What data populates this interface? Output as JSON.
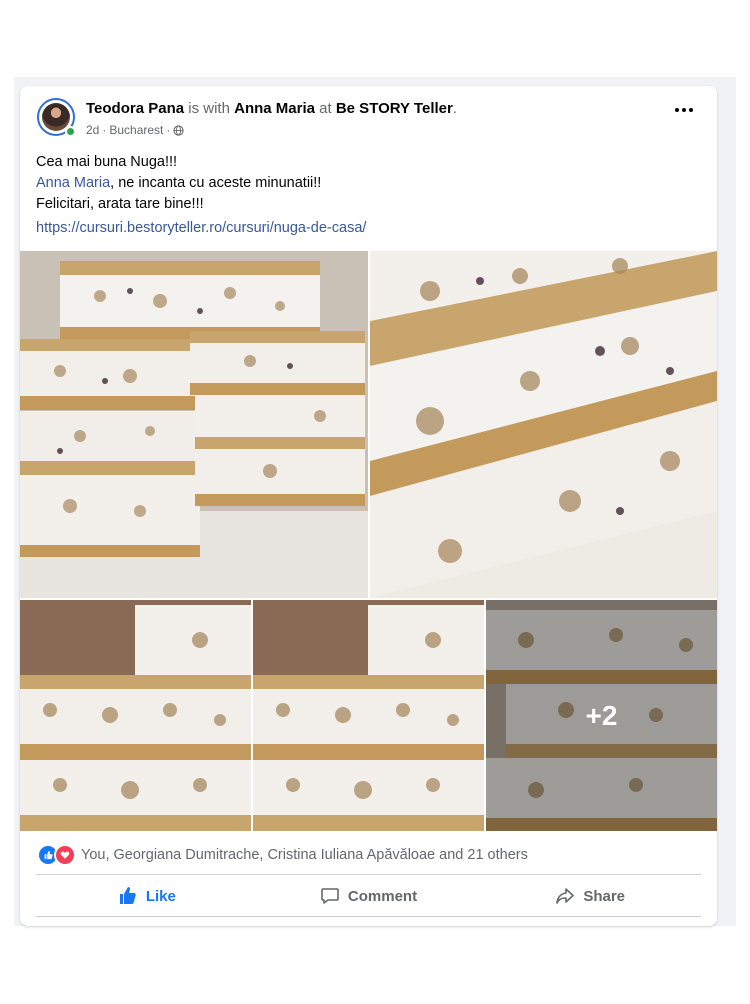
{
  "post": {
    "author": "Teodora Pana",
    "with_text": "is with",
    "tagged": "Anna Maria",
    "at_text": "at",
    "place": "Be STORY Teller",
    "period": ".",
    "time": "2d",
    "location": "Bucharest",
    "audience_icon": "globe-icon",
    "text_line1": "Cea mai buna Nuga!!!",
    "mention": "Anna Maria",
    "text_line2_rest": ", ne incanta cu aceste minunatii!!",
    "text_line3": "Felicitari, arata tare bine!!!",
    "link": "https://cursuri.bestoryteller.ro/cursuri/nuga-de-casa/",
    "more_photos": "+2"
  },
  "reactions": {
    "summary": "You, Georgiana Dumitrache, Cristina Iuliana Apăvăloae and 21 others"
  },
  "actions": {
    "like": "Like",
    "comment": "Comment",
    "share": "Share"
  },
  "colors": {
    "accent": "#1877f2",
    "link": "#385898",
    "love": "#f33e58"
  }
}
